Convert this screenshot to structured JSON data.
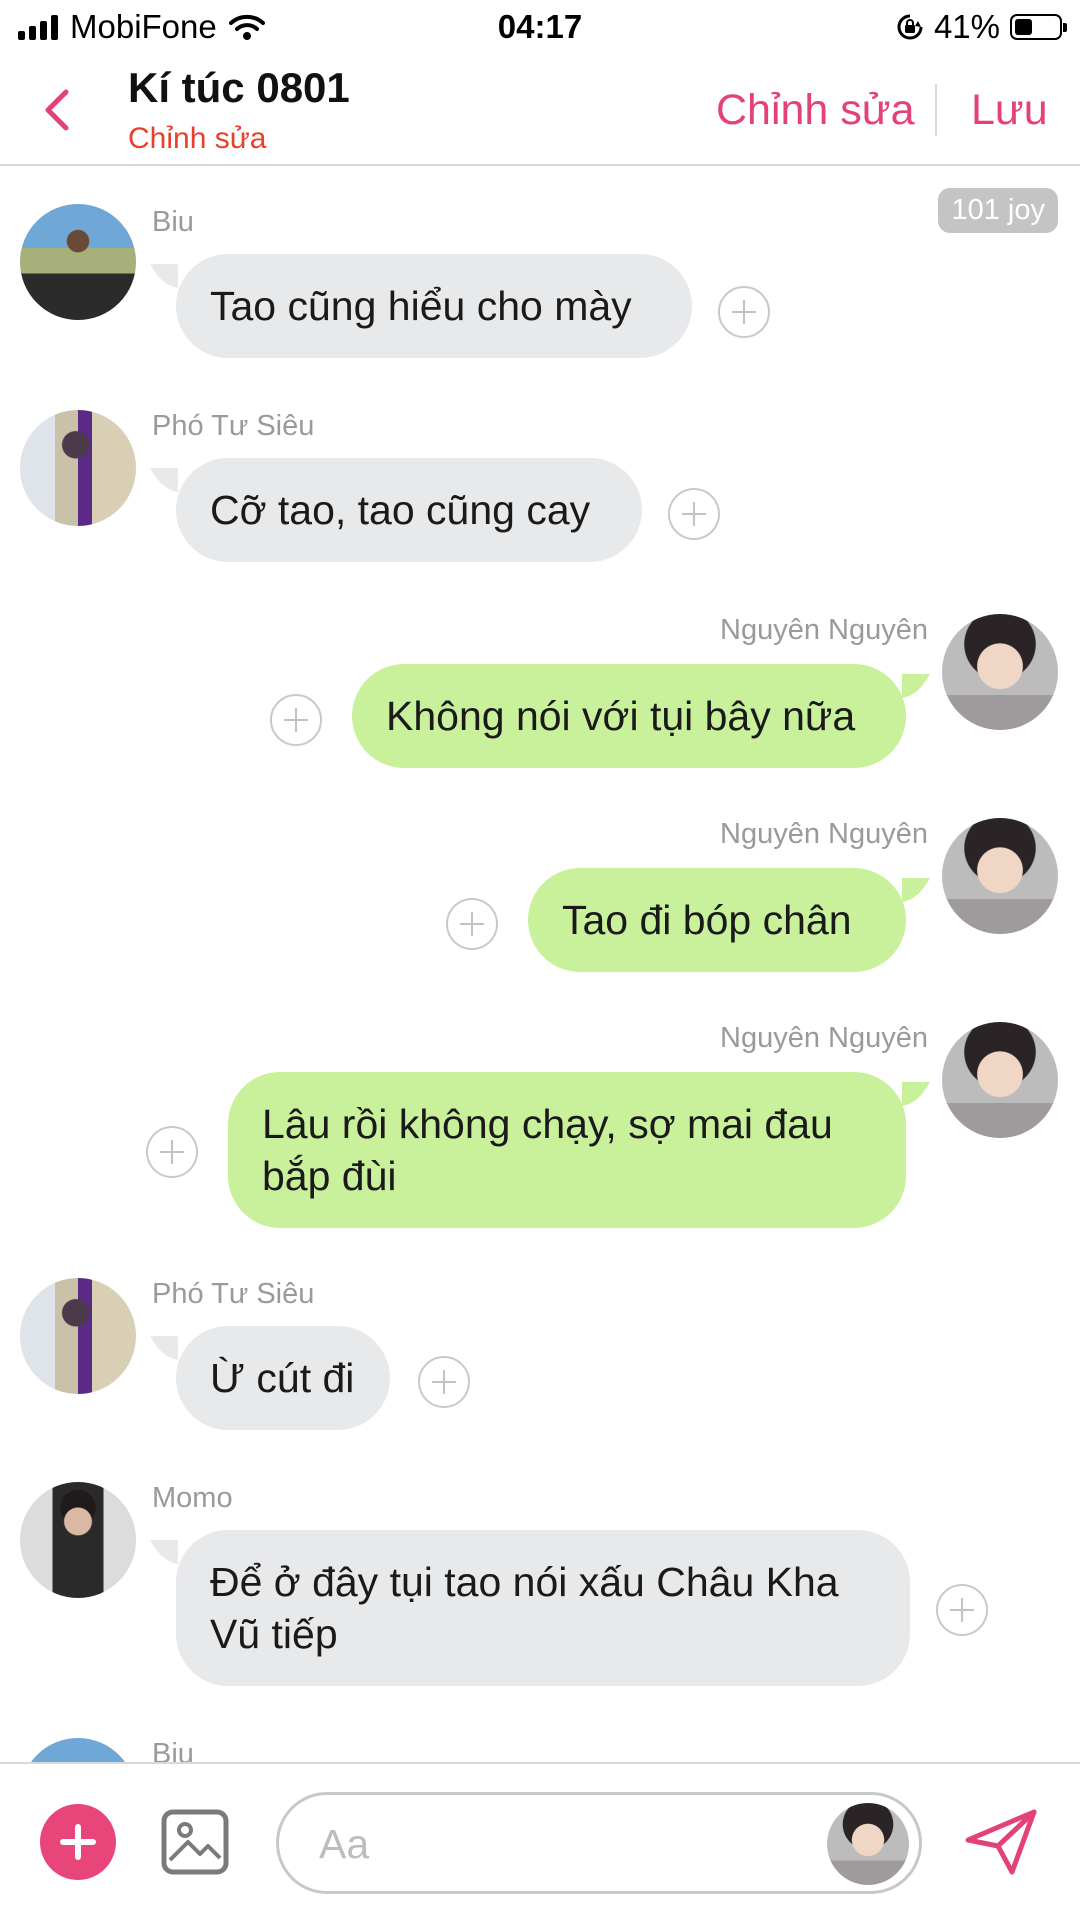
{
  "status_bar": {
    "carrier": "MobiFone",
    "time": "04:17",
    "battery": "41%",
    "battery_level": 0.41
  },
  "header": {
    "title": "Kí túc 0801",
    "subtitle": "Chỉnh sửa",
    "edit_label": "Chỉnh sửa",
    "save_label": "Lưu"
  },
  "chat": {
    "joy_badge": "101 joy",
    "messages": [
      {
        "sender": "Biu",
        "text": "Tao cũng hiểu cho mày",
        "side": "left"
      },
      {
        "sender": "Phó Tư Siêu",
        "text": "Cỡ tao, tao cũng cay",
        "side": "left"
      },
      {
        "sender": "Nguyên Nguyên",
        "text": "Không nói với tụi bây nữa",
        "side": "right"
      },
      {
        "sender": "Nguyên Nguyên",
        "text": "Tao đi bóp chân",
        "side": "right"
      },
      {
        "sender": "Nguyên Nguyên",
        "text": "Lâu rồi không chạy, sợ mai đau bắp đùi",
        "side": "right"
      },
      {
        "sender": "Phó Tư Siêu",
        "text": "Ừ cút đi",
        "side": "left"
      },
      {
        "sender": "Momo",
        "text": "Để ở đây tụi tao nói xấu Châu Kha Vũ tiếp",
        "side": "left"
      },
      {
        "sender": "Biu",
        "text": "",
        "side": "left"
      }
    ]
  },
  "composer": {
    "placeholder": "Aa"
  },
  "colors": {
    "accent": "#e2417a",
    "subtitle": "#e8412b",
    "bubble_in": "#e8e9eb",
    "bubble_out": "#c9f09b"
  },
  "icons": [
    "back-chevron-icon",
    "signal-icon",
    "wifi-icon",
    "rotation-lock-icon",
    "battery-icon",
    "plus-icon",
    "image-icon",
    "send-icon"
  ]
}
